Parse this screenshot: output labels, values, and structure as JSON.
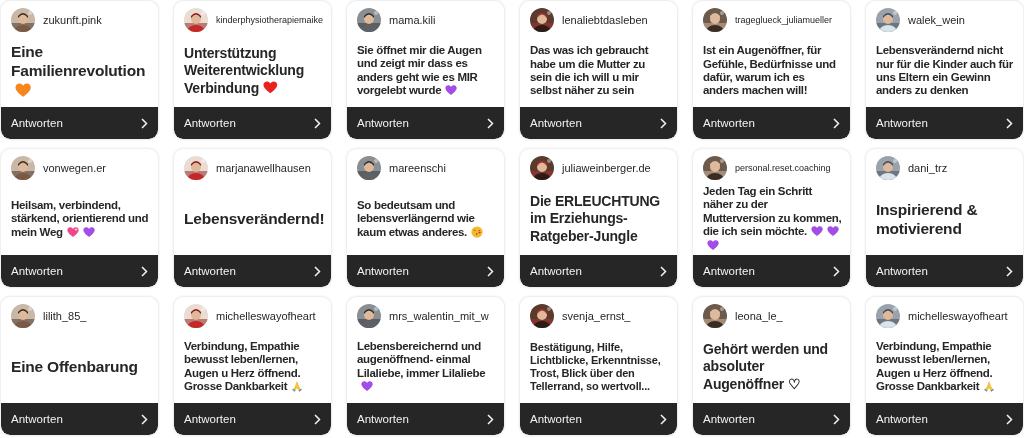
{
  "cards": [
    {
      "username": "zukunft.pink",
      "answer": "Eine Familienrevolution",
      "emojis": [
        {
          "kind": "heart",
          "color": "#f7861e"
        }
      ],
      "reply": "Antworten"
    },
    {
      "username": "kinderphysiotherapiemaike",
      "answer": "Unterstützung Weiterentwicklung Verbindung",
      "emojis": [
        {
          "kind": "heart",
          "color": "#e8231f"
        }
      ],
      "reply": "Antworten"
    },
    {
      "username": "mama.kili",
      "answer": "Sie öffnet mir die Augen und zeigt mir dass es anders geht wie es MIR vorgelebt wurde",
      "emojis": [
        {
          "kind": "heart",
          "color": "#a24de8"
        }
      ],
      "reply": "Antworten"
    },
    {
      "username": "lenaliebtdasleben",
      "answer": "Das was ich gebraucht habe um die Mutter zu sein die ich will u mir selbst näher zu sein",
      "reply": "Antworten"
    },
    {
      "username": "trageglueck_juliamueller",
      "answer": "Ist ein Augenöffner, für Gefühle, Bedürfnisse und dafür, warum ich es anders machen will!",
      "reply": "Antworten"
    },
    {
      "username": "walek_wein",
      "answer": "Lebensverändernd nicht nur für die Kinder auch für uns Eltern ein Gewinn anders zu denken",
      "reply": "Antworten"
    },
    {
      "username": "vonwegen.er",
      "answer": "Heilsam, verbindend, stärkend, orientierend und mein Weg",
      "emojis": [
        {
          "kind": "sparkling-heart",
          "color": "#f0468c"
        },
        {
          "kind": "heart",
          "color": "#a24de8"
        }
      ],
      "reply": "Antworten"
    },
    {
      "username": "marjanawellhausen",
      "answer": "Lebensverändernd!",
      "reply": "Antworten"
    },
    {
      "username": "mareenschi",
      "answer": "So bedeutsam und lebensverlängernd wie kaum etwas anderes.",
      "emojis": [
        {
          "kind": "kiss",
          "color": "#f5b92e"
        }
      ],
      "reply": "Antworten"
    },
    {
      "username": "juliaweinberger.de",
      "answer": "Die ERLEUCHTUNG im Erziehungs-Ratgeber-Jungle",
      "reply": "Antworten"
    },
    {
      "username": "personal.reset.coaching",
      "answer": "Jeden Tag ein Schritt näher zu der Mutterversion zu kommen, die ich sein möchte.",
      "emojis": [
        {
          "kind": "heart",
          "color": "#a24de8"
        },
        {
          "kind": "heart",
          "color": "#a24de8"
        },
        {
          "kind": "heart",
          "color": "#a24de8"
        }
      ],
      "reply": "Antworten"
    },
    {
      "username": "dani_trz",
      "answer": "Inspirierend & motivierend",
      "reply": "Antworten"
    },
    {
      "username": "lilith_85_",
      "answer": "Eine Offenbarung",
      "reply": "Antworten"
    },
    {
      "username": "michelleswayofheart",
      "answer": "Verbindung, Empathie bewusst leben/lernen, Augen u Herz öffnend. Grosse Dankbarkeit",
      "emojis": [
        {
          "kind": "pray",
          "color": "#f5c33b"
        }
      ],
      "reply": "Antworten"
    },
    {
      "username": "mrs_walentin_mit_w",
      "answer": "Lebensbereichernd und augenöffnend- einmal Lilaliebe, immer Lilaliebe",
      "emojis": [
        {
          "kind": "heart",
          "color": "#a24de8"
        }
      ],
      "reply": "Antworten"
    },
    {
      "username": "svenja_ernst_",
      "answer": "Bestätigung, Hilfe, Lichtblicke, Erkenntnisse, Trost, Blick über den Tellerrand, so wertvoll...",
      "reply": "Antworten"
    },
    {
      "username": "leona_le_",
      "answer": "Gehört werden und absoluter Augenöffner ♡",
      "reply": "Antworten"
    },
    {
      "username": "michelleswayofheart",
      "answer": "Verbindung, Empathie bewusst leben/lernen, Augen u Herz öffnend. Grosse Dankbarkeit",
      "emojis": [
        {
          "kind": "pray",
          "color": "#f5c33b"
        }
      ],
      "reply": "Antworten"
    }
  ]
}
